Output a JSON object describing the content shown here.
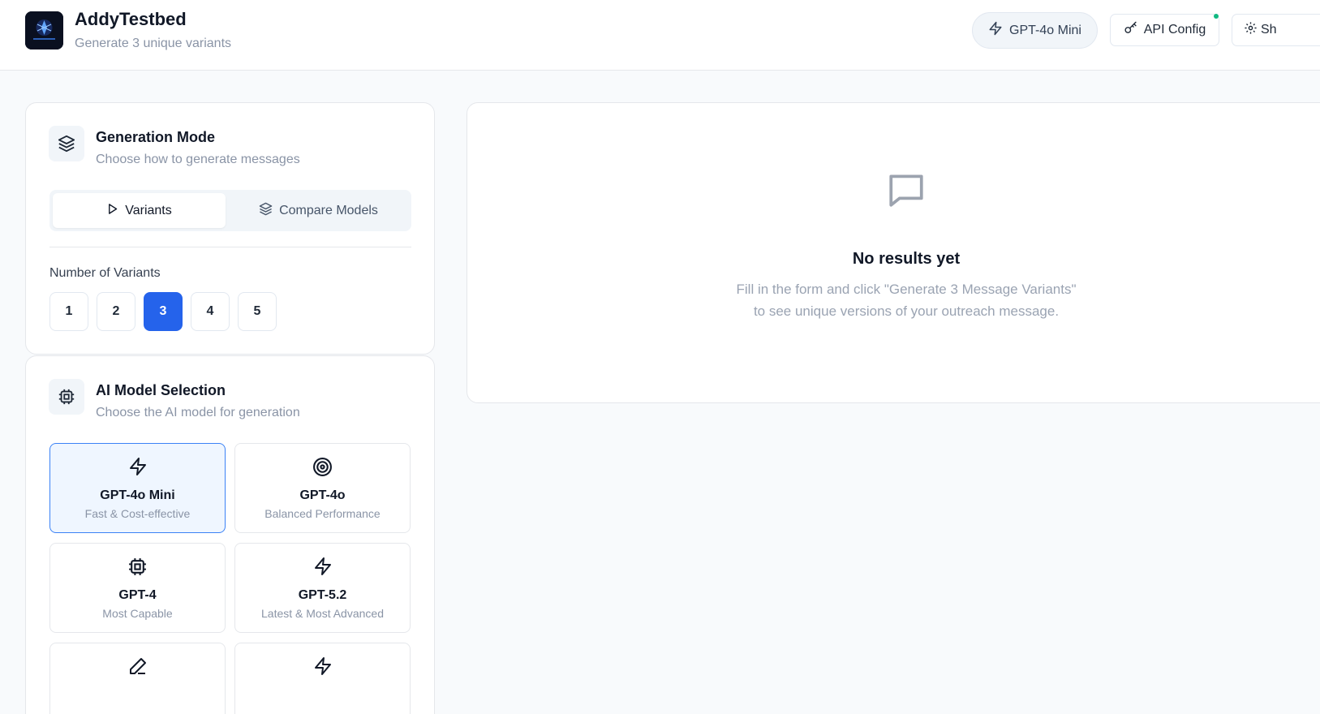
{
  "header": {
    "app_title": "AddyTestbed",
    "app_subtitle": "Generate 3 unique variants",
    "logo_text": "AddyTestbed",
    "model_pill_label": "GPT-4o Mini",
    "api_config_label": "API Config",
    "share_label": "Sh"
  },
  "generation_mode": {
    "title": "Generation Mode",
    "subtitle": "Choose how to generate messages",
    "tabs": [
      {
        "label": "Variants",
        "active": true
      },
      {
        "label": "Compare Models",
        "active": false
      }
    ],
    "variants_label": "Number of Variants",
    "variant_options": [
      "1",
      "2",
      "3",
      "4",
      "5"
    ],
    "selected_variant": "3"
  },
  "model_selection": {
    "title": "AI Model Selection",
    "subtitle": "Choose the AI model for generation",
    "models": [
      {
        "name": "GPT-4o Mini",
        "desc": "Fast & Cost-effective",
        "icon": "zap-icon",
        "active": true
      },
      {
        "name": "GPT-4o",
        "desc": "Balanced Performance",
        "icon": "target-icon",
        "active": false
      },
      {
        "name": "GPT-4",
        "desc": "Most Capable",
        "icon": "cpu-icon",
        "active": false
      },
      {
        "name": "GPT-5.2",
        "desc": "Latest & Most Advanced",
        "icon": "zap-icon",
        "active": false
      },
      {
        "name": "",
        "desc": "",
        "icon": "pen-icon",
        "active": false
      },
      {
        "name": "",
        "desc": "",
        "icon": "zap-icon",
        "active": false
      }
    ]
  },
  "results": {
    "empty_title": "No results yet",
    "empty_text": "Fill in the form and click \"Generate 3 Message Variants\" to see unique versions of your outreach message."
  },
  "colors": {
    "accent": "#2563eb",
    "status_dot": "#10b981",
    "active_card_bg": "#eff6ff"
  }
}
